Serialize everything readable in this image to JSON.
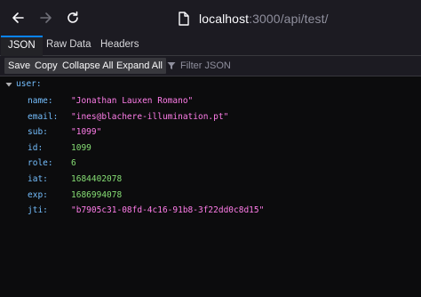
{
  "browser": {
    "url_host": "localhost",
    "url_path": ":3000/api/test/"
  },
  "tabs": [
    {
      "label": "JSON"
    },
    {
      "label": "Raw Data"
    },
    {
      "label": "Headers"
    }
  ],
  "json_toolbar": {
    "save": "Save",
    "copy": "Copy",
    "collapse_all": "Collapse All",
    "expand_all": "Expand All",
    "filter_placeholder": "Filter JSON"
  },
  "tree": {
    "root_key": "user:",
    "rows": [
      {
        "key": "name:",
        "value": "\"Jonathan Lauxen Romano\"",
        "kind": "string"
      },
      {
        "key": "email:",
        "value": "\"ines@blachere-illumination.pt\"",
        "kind": "string"
      },
      {
        "key": "sub:",
        "value": "\"1099\"",
        "kind": "string"
      },
      {
        "key": "id:",
        "value": "1099",
        "kind": "number"
      },
      {
        "key": "role:",
        "value": "6",
        "kind": "number"
      },
      {
        "key": "iat:",
        "value": "1684402078",
        "kind": "number"
      },
      {
        "key": "exp:",
        "value": "1686994078",
        "kind": "number"
      },
      {
        "key": "jti:",
        "value": "\"b7905c31-08fd-4c16-91b8-3f22dd0c8d15\"",
        "kind": "string"
      }
    ]
  },
  "colors": {
    "key": "#75bfff",
    "string": "#ff7de9",
    "number": "#86de74",
    "accent": "#0a84ff"
  }
}
